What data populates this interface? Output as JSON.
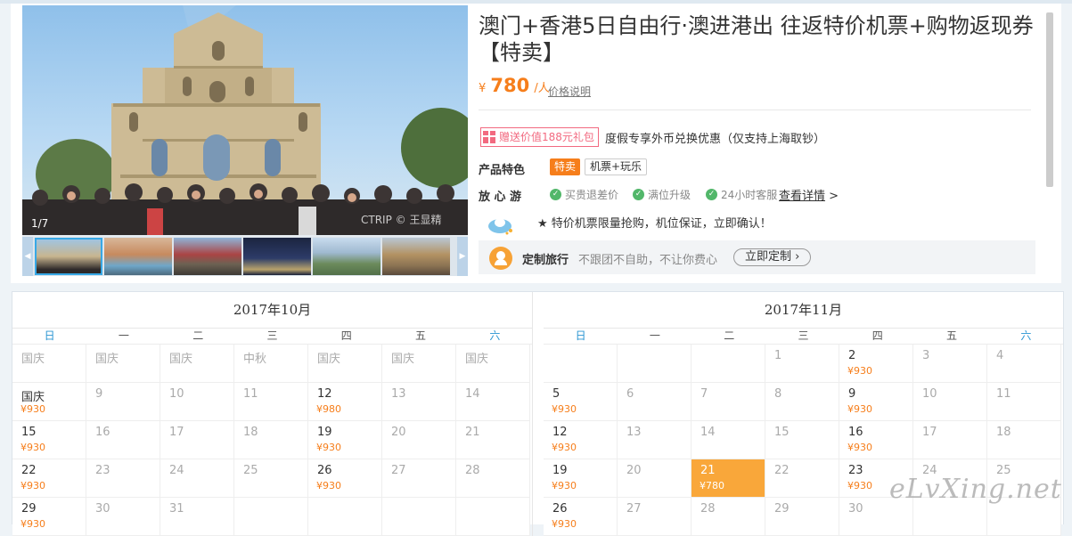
{
  "gallery": {
    "counter": "1/7",
    "watermark": "CTRIP © 王显精",
    "thumbnails": [
      "ruins",
      "venetian",
      "temple",
      "ferris-wheel",
      "hills",
      "street"
    ]
  },
  "product": {
    "title": "澳门+香港5日自由行·澳进港出 往返特价机票+购物返现券【特卖】",
    "price_currency": "¥",
    "price_value": "780",
    "price_unit": "/人",
    "price_note": "价格说明",
    "gift_badge": "赠送价值188元礼包",
    "gift_text": "度假专享外币兑换优惠（仅支持上海取钞）",
    "feature_label": "产品特色",
    "feature_tags": [
      "特卖",
      "机票+玩乐"
    ],
    "assurance_label": "放 心 游",
    "assurances": [
      "买贵退差价",
      "满位升级",
      "24小时客服"
    ],
    "assurance_link": "查看详情",
    "assurance_arrow": ">",
    "promo_text": "★ 特价机票限量抢购，机位保证，立即确认！",
    "custom_title": "定制旅行",
    "custom_desc": "不跟团不自助，不让你费心",
    "custom_button": "立即定制 ›"
  },
  "calendar": {
    "weekdays": [
      "日",
      "一",
      "二",
      "三",
      "四",
      "五",
      "六"
    ],
    "months": [
      {
        "title": "2017年10月",
        "rows": [
          [
            {
              "d": "国庆",
              "p": "",
              "dim": true
            },
            {
              "d": "国庆",
              "p": "",
              "dim": true
            },
            {
              "d": "国庆",
              "p": "",
              "dim": true
            },
            {
              "d": "中秋",
              "p": "",
              "dim": true
            },
            {
              "d": "国庆",
              "p": "",
              "dim": true
            },
            {
              "d": "国庆",
              "p": "",
              "dim": true
            },
            {
              "d": "国庆",
              "p": "",
              "dim": true
            }
          ],
          [
            {
              "d": "国庆",
              "p": "¥930"
            },
            {
              "d": "9",
              "p": "",
              "dim": true
            },
            {
              "d": "10",
              "p": "",
              "dim": true
            },
            {
              "d": "11",
              "p": "",
              "dim": true
            },
            {
              "d": "12",
              "p": "¥980"
            },
            {
              "d": "13",
              "p": "",
              "dim": true
            },
            {
              "d": "14",
              "p": "",
              "dim": true
            }
          ],
          [
            {
              "d": "15",
              "p": "¥930"
            },
            {
              "d": "16",
              "p": "",
              "dim": true
            },
            {
              "d": "17",
              "p": "",
              "dim": true
            },
            {
              "d": "18",
              "p": "",
              "dim": true
            },
            {
              "d": "19",
              "p": "¥930"
            },
            {
              "d": "20",
              "p": "",
              "dim": true
            },
            {
              "d": "21",
              "p": "",
              "dim": true
            }
          ],
          [
            {
              "d": "22",
              "p": "¥930"
            },
            {
              "d": "23",
              "p": "",
              "dim": true
            },
            {
              "d": "24",
              "p": "",
              "dim": true
            },
            {
              "d": "25",
              "p": "",
              "dim": true
            },
            {
              "d": "26",
              "p": "¥930"
            },
            {
              "d": "27",
              "p": "",
              "dim": true
            },
            {
              "d": "28",
              "p": "",
              "dim": true
            }
          ],
          [
            {
              "d": "29",
              "p": "¥930"
            },
            {
              "d": "30",
              "p": "",
              "dim": true
            },
            {
              "d": "31",
              "p": "",
              "dim": true
            },
            {
              "d": "",
              "p": ""
            },
            {
              "d": "",
              "p": ""
            },
            {
              "d": "",
              "p": ""
            },
            {
              "d": "",
              "p": ""
            }
          ]
        ]
      },
      {
        "title": "2017年11月",
        "rows": [
          [
            {
              "d": "",
              "p": ""
            },
            {
              "d": "",
              "p": ""
            },
            {
              "d": "",
              "p": ""
            },
            {
              "d": "1",
              "p": "",
              "dim": true
            },
            {
              "d": "2",
              "p": "¥930"
            },
            {
              "d": "3",
              "p": "",
              "dim": true
            },
            {
              "d": "4",
              "p": "",
              "dim": true
            }
          ],
          [
            {
              "d": "5",
              "p": "¥930"
            },
            {
              "d": "6",
              "p": "",
              "dim": true
            },
            {
              "d": "7",
              "p": "",
              "dim": true
            },
            {
              "d": "8",
              "p": "",
              "dim": true
            },
            {
              "d": "9",
              "p": "¥930"
            },
            {
              "d": "10",
              "p": "",
              "dim": true
            },
            {
              "d": "11",
              "p": "",
              "dim": true
            }
          ],
          [
            {
              "d": "12",
              "p": "¥930"
            },
            {
              "d": "13",
              "p": "",
              "dim": true
            },
            {
              "d": "14",
              "p": "",
              "dim": true
            },
            {
              "d": "15",
              "p": "",
              "dim": true
            },
            {
              "d": "16",
              "p": "¥930"
            },
            {
              "d": "17",
              "p": "",
              "dim": true
            },
            {
              "d": "18",
              "p": "",
              "dim": true
            }
          ],
          [
            {
              "d": "19",
              "p": "¥930"
            },
            {
              "d": "20",
              "p": "",
              "dim": true
            },
            {
              "d": "21",
              "p": "¥780",
              "sel": true
            },
            {
              "d": "22",
              "p": "",
              "dim": true
            },
            {
              "d": "23",
              "p": "¥930"
            },
            {
              "d": "24",
              "p": "",
              "dim": true
            },
            {
              "d": "25",
              "p": "",
              "dim": true
            }
          ],
          [
            {
              "d": "26",
              "p": "¥930"
            },
            {
              "d": "27",
              "p": "",
              "dim": true
            },
            {
              "d": "28",
              "p": "",
              "dim": true
            },
            {
              "d": "29",
              "p": "",
              "dim": true
            },
            {
              "d": "30",
              "p": "",
              "dim": true
            },
            {
              "d": "",
              "p": ""
            },
            {
              "d": "",
              "p": ""
            }
          ]
        ]
      }
    ]
  },
  "site_watermark": "eLvXing.net",
  "colors": {
    "accent": "#f67e1b",
    "selected": "#f9a73a",
    "weekend": "#2894d2",
    "gift": "#f26a80"
  }
}
